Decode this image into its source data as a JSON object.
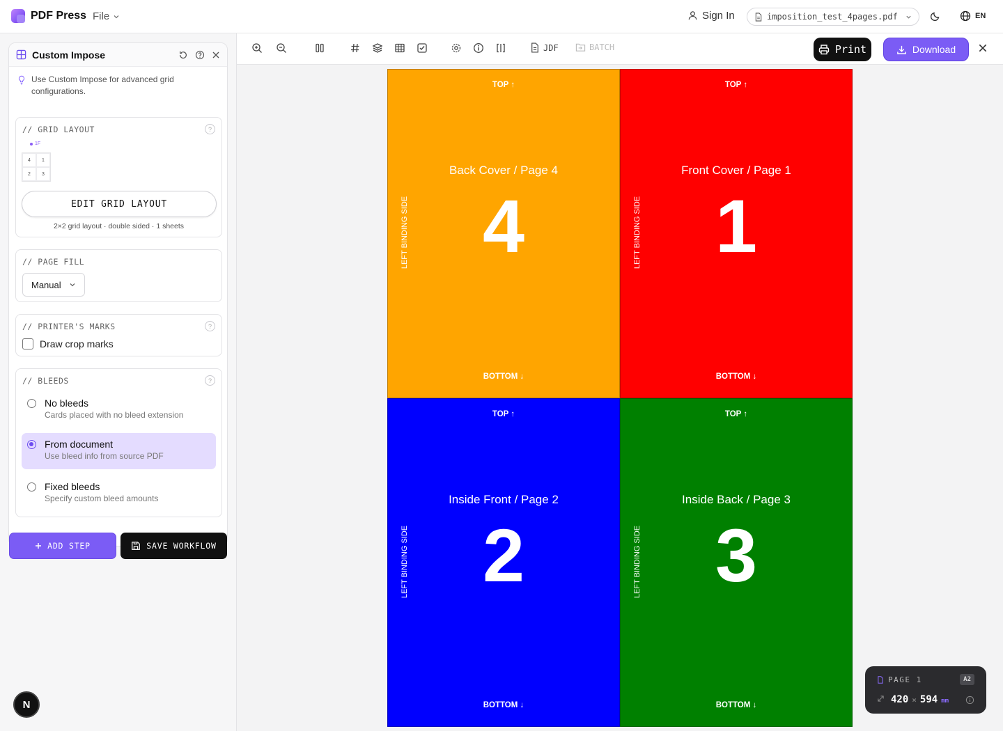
{
  "app": {
    "name": "PDF Press",
    "file_menu": "File",
    "sign_in": "Sign In",
    "file_name": "imposition_test_4pages.pdf",
    "lang": "EN"
  },
  "panel": {
    "title": "Custom Impose",
    "tip": "Use Custom Impose for advanced grid configurations.",
    "grid_layout": {
      "title": "// GRID LAYOUT",
      "mini_label": "1F",
      "mini_cells": [
        "4",
        "1",
        "2",
        "3"
      ],
      "edit_button": "EDIT GRID LAYOUT",
      "summary": "2×2 grid layout · double sided · 1 sheets"
    },
    "page_fill": {
      "title": "// PAGE FILL",
      "value": "Manual"
    },
    "printers_marks": {
      "title": "// PRINTER'S MARKS",
      "crop_label": "Draw crop marks"
    },
    "bleeds": {
      "title": "// BLEEDS",
      "options": [
        {
          "title": "No bleeds",
          "sub": "Cards placed with no bleed extension"
        },
        {
          "title": "From document",
          "sub": "Use bleed info from source PDF"
        },
        {
          "title": "Fixed bleeds",
          "sub": "Specify custom bleed amounts"
        }
      ]
    },
    "add_step": "ADD STEP",
    "save_workflow": "SAVE WORKFLOW"
  },
  "toolbar": {
    "jdf": "JDF",
    "batch": "BATCH",
    "print": "Print",
    "download": "Download"
  },
  "sheet": {
    "pages": [
      {
        "top": "TOP ↑",
        "bottom": "BOTTOM ↓",
        "title": "Back Cover / Page 4",
        "number": "4",
        "side": "LEFT BINDING SIDE",
        "color": "#ffa500"
      },
      {
        "top": "TOP ↑",
        "bottom": "BOTTOM ↓",
        "title": "Front Cover / Page 1",
        "number": "1",
        "side": "LEFT BINDING SIDE",
        "color": "#ff0000"
      },
      {
        "top": "TOP ↑",
        "bottom": "BOTTOM ↓",
        "title": "Inside Front / Page 2",
        "number": "2",
        "side": "LEFT BINDING SIDE",
        "color": "#0000ff"
      },
      {
        "top": "TOP ↑",
        "bottom": "BOTTOM ↓",
        "title": "Inside Back / Page 3",
        "number": "3",
        "side": "LEFT BINDING SIDE",
        "color": "#008000"
      }
    ]
  },
  "page_info": {
    "label": "PAGE 1",
    "badge": "A2",
    "width": "420",
    "x": "×",
    "height": "594",
    "unit": "mm"
  },
  "badge": "N"
}
